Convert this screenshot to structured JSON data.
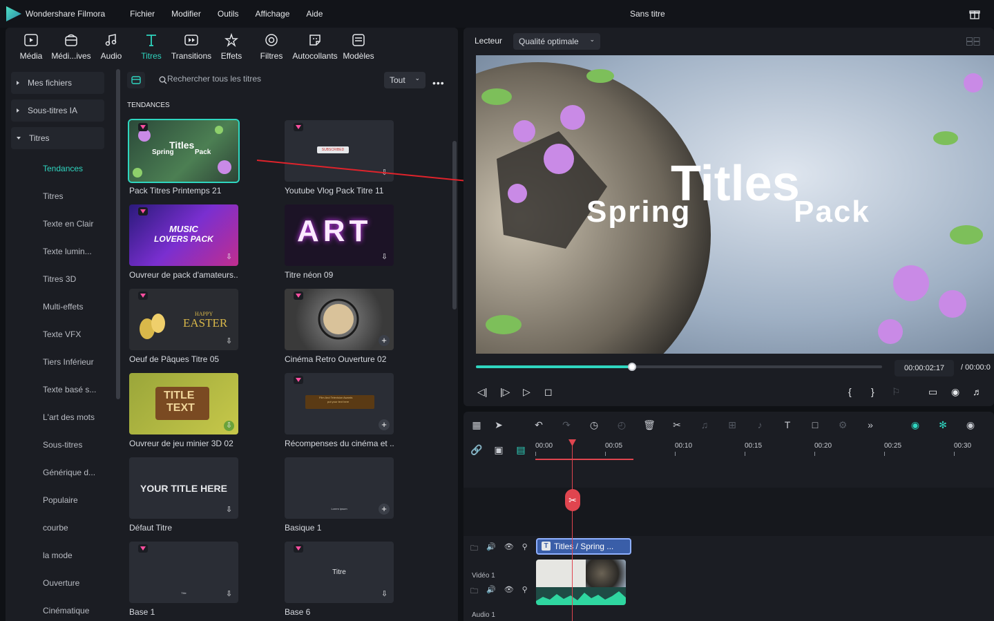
{
  "app": {
    "name": "Wondershare Filmora",
    "doc_title": "Sans titre"
  },
  "menu": [
    "Fichier",
    "Modifier",
    "Outils",
    "Affichage",
    "Aide"
  ],
  "toolbar": [
    {
      "label": "Média",
      "icon": "media-icon"
    },
    {
      "label": "Médi...ives",
      "icon": "stock-media-icon"
    },
    {
      "label": "Audio",
      "icon": "audio-icon"
    },
    {
      "label": "Titres",
      "icon": "titles-icon",
      "active": true
    },
    {
      "label": "Transitions",
      "icon": "transitions-icon"
    },
    {
      "label": "Effets",
      "icon": "effects-icon"
    },
    {
      "label": "Filtres",
      "icon": "filters-icon"
    },
    {
      "label": "Autocollants",
      "icon": "stickers-icon"
    },
    {
      "label": "Modèles",
      "icon": "templates-icon"
    }
  ],
  "sidebar": {
    "groups": [
      "Mes fichiers",
      "Sous-titres IA",
      "Titres"
    ],
    "items": [
      "Tendances",
      "Titres",
      "Texte en Clair",
      "Texte lumin...",
      "Titres 3D",
      "Multi-effets",
      "Texte VFX",
      "Tiers Inférieur",
      "Texte basé s...",
      "L'art des mots",
      "Sous-titres",
      "Générique d...",
      "Populaire",
      "courbe",
      "la mode",
      "Ouverture",
      "Cinématique"
    ],
    "active_item": "Tendances"
  },
  "search": {
    "placeholder": "Rechercher tous les titres",
    "filter": "Tout"
  },
  "section_title": "TENDANCES",
  "cards": [
    {
      "label": "Pack Titres Printemps 21"
    },
    {
      "label": "Youtube Vlog Pack Titre 11"
    },
    {
      "label": "Ouvreur de pack d'amateurs..."
    },
    {
      "label": "Titre néon 09"
    },
    {
      "label": "Oeuf de Pâques Titre 05"
    },
    {
      "label": "Cinéma Retro Ouverture 02"
    },
    {
      "label": "Ouvreur de jeu minier 3D 02"
    },
    {
      "label": "Récompenses du cinéma et ..."
    },
    {
      "label": "Défaut Titre"
    },
    {
      "label": "Basique 1"
    },
    {
      "label": "Base 1"
    },
    {
      "label": "Base 6"
    }
  ],
  "thumb_text": {
    "spring_titles": "Titles",
    "spring_sub": "Spring",
    "spring_pack": "Pack",
    "subscribed": "SUBSCRIBED",
    "music1": "MUSIC",
    "music2": "LOVERS PACK",
    "art": "ART",
    "happy": "HAPPY",
    "easter": "EASTER",
    "title3d1": "TITLE",
    "title3d2": "TEXT",
    "awards": "Film And Television Awards",
    "awards_sub": "put your text here",
    "your_title": "YOUR TITLE HERE",
    "lorem": "Lorem ipsum",
    "title_small": "Title",
    "titre": "Titre"
  },
  "player": {
    "label": "Lecteur",
    "quality": "Qualité optimale",
    "preview_title": "Titles",
    "preview_sub1": "Spring",
    "preview_sub2": "Pack",
    "timecode": "00:00:02:17",
    "timecode_total": "/ 00:00:0",
    "progress": 0.385
  },
  "timeline": {
    "ruler": [
      "00:00",
      "00:05",
      "00:10",
      "00:15",
      "00:20",
      "00:25",
      "00:30"
    ],
    "title_clip": "Titles / Spring ...",
    "track_video": "Vidéo 1",
    "track_audio": "Audio 1"
  },
  "colors": {
    "accent": "#2fd6c0",
    "playhead": "#e0454f",
    "title_clip": "#3a5ea8"
  }
}
